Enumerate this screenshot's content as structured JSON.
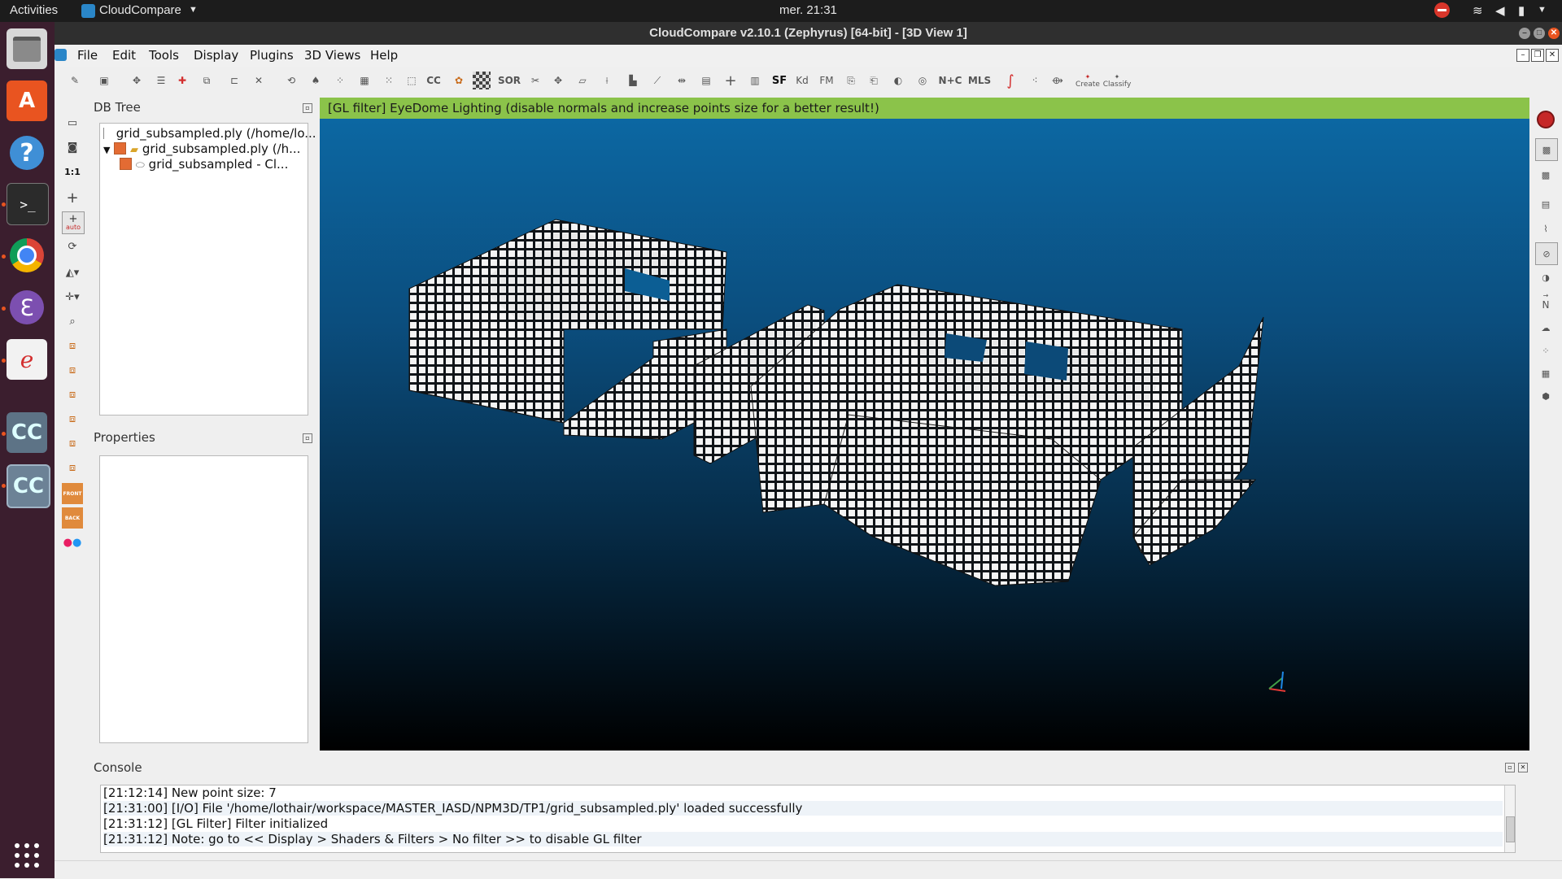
{
  "topbar": {
    "activities": "Activities",
    "app_name": "CloudCompare",
    "clock": "mer. 21:31"
  },
  "window": {
    "title": "CloudCompare v2.10.1 (Zephyrus) [64-bit] - [3D View 1]"
  },
  "menu": [
    "File",
    "Edit",
    "Tools",
    "Display",
    "Plugins",
    "3D Views",
    "Help"
  ],
  "toolbar": {
    "cc_label": "CC",
    "sor_label": "SOR",
    "sf_label": "SF",
    "kd_label": "Kd",
    "fm_label": "FM",
    "nc_label": "N+C",
    "mls_label": "MLS",
    "canupo_create": "Create",
    "canupo_classify": "Classify"
  },
  "left_tools": {
    "zoom_ratio": "1:1",
    "auto_label": "auto",
    "front_label": "FRONT",
    "back_label": "BACK"
  },
  "db_tree": {
    "header": "DB Tree",
    "items": [
      {
        "label": "grid_subsampled.ply (/home/lo..."
      },
      {
        "label": "grid_subsampled.ply (/h..."
      },
      {
        "label": "grid_subsampled - Cl..."
      }
    ]
  },
  "properties": {
    "header": "Properties"
  },
  "view3d": {
    "gl_filter_message": "[GL filter] EyeDome Lighting (disable normals and increase points size for a better result!)"
  },
  "right_tools": {
    "north_label": "N"
  },
  "console": {
    "header": "Console",
    "lines": [
      "[21:12:14] New point size: 7",
      "[21:31:00] [I/O] File '/home/lothair/workspace/MASTER_IASD/NPM3D/TP1/grid_subsampled.ply' loaded successfully",
      "[21:31:12] [GL Filter] Filter initialized",
      "[21:31:12] Note: go to << Display > Shaders & Filters > No filter >> to disable GL filter"
    ]
  },
  "colors": {
    "gl_bar": "#8bc34a",
    "view_top": "#0c6aa6",
    "view_bottom": "#000000",
    "dock": "#3b1e2e",
    "accent": "#e95420"
  }
}
